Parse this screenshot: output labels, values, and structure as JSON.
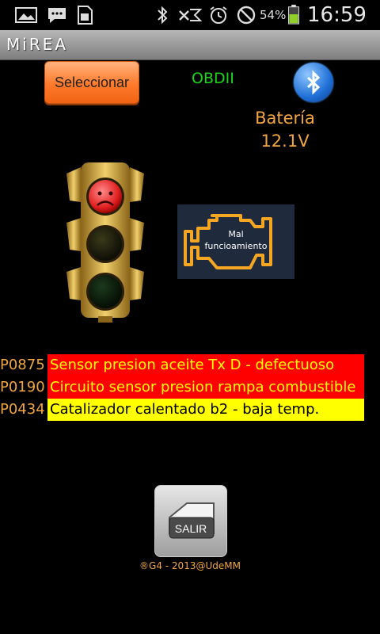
{
  "statusbar": {
    "battery_percent": "54%",
    "battery_level": 0.54,
    "time": "16:59",
    "icons": [
      "gallery-icon",
      "messenger-icon",
      "sim-icon",
      "bluetooth-icon",
      "signal-off-icon",
      "alarm-icon",
      "no-sim-icon",
      "battery-icon"
    ]
  },
  "app": {
    "title": "MiREA"
  },
  "toolbar": {
    "select_label": "Seleccionar",
    "obd_label": "OBDII"
  },
  "battery": {
    "label": "Batería",
    "voltage": "12.1V"
  },
  "status": {
    "traffic_light": "red",
    "engine_text_line1": "Mal",
    "engine_text_line2": "funcioamiento"
  },
  "colors": {
    "orange": "#f2a640",
    "green": "#19d619",
    "red": "#ff0000",
    "yellow": "#ffff00"
  },
  "codes": [
    {
      "code": "P0875",
      "description": "Sensor presion aceite Tx D - defectuoso",
      "severity": "red"
    },
    {
      "code": "P0190",
      "description": "Circuito sensor presion rampa combustible",
      "severity": "red"
    },
    {
      "code": "P0434",
      "description": "Catalizador calentado b2 - baja temp.",
      "severity": "yellow"
    }
  ],
  "exit": {
    "label": "SALIR"
  },
  "footer": {
    "text": "®G4 - 2013@UdeMM"
  }
}
